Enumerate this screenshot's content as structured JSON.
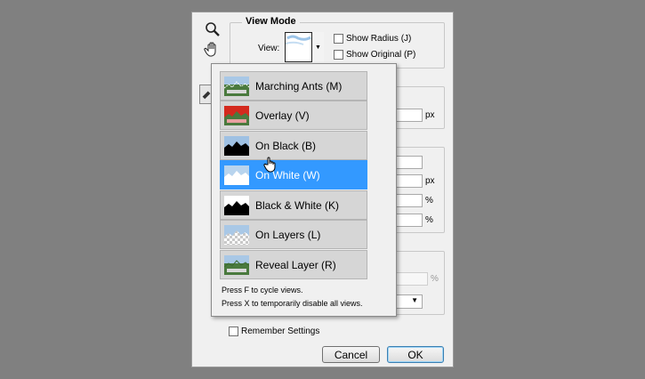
{
  "dialog": {
    "view_mode_title": "View Mode",
    "view_label": "View:",
    "show_radius": "Show Radius (J)",
    "show_original": "Show Original (P)",
    "unit_px": "px",
    "unit_percent": "%",
    "remember_settings": "Remember Settings",
    "cancel_label": "Cancel",
    "ok_label": "OK"
  },
  "menu": {
    "items": [
      {
        "label": "Marching Ants (M)",
        "thumb": "marching-ants-thumb"
      },
      {
        "label": "Overlay (V)",
        "thumb": "overlay-thumb"
      },
      {
        "label": "On Black (B)",
        "thumb": "on-black-thumb"
      },
      {
        "label": "On White (W)",
        "thumb": "on-white-thumb",
        "selected": true
      },
      {
        "label": "Black & White (K)",
        "thumb": "black-white-thumb"
      },
      {
        "label": "On Layers (L)",
        "thumb": "on-layers-thumb"
      },
      {
        "label": "Reveal Layer (R)",
        "thumb": "reveal-layer-thumb"
      }
    ],
    "hint1": "Press F to cycle views.",
    "hint2": "Press X to temporarily disable all views."
  },
  "colors": {
    "selection": "#3399ff",
    "overlay_red": "#d42a1e",
    "background": "#808080"
  }
}
